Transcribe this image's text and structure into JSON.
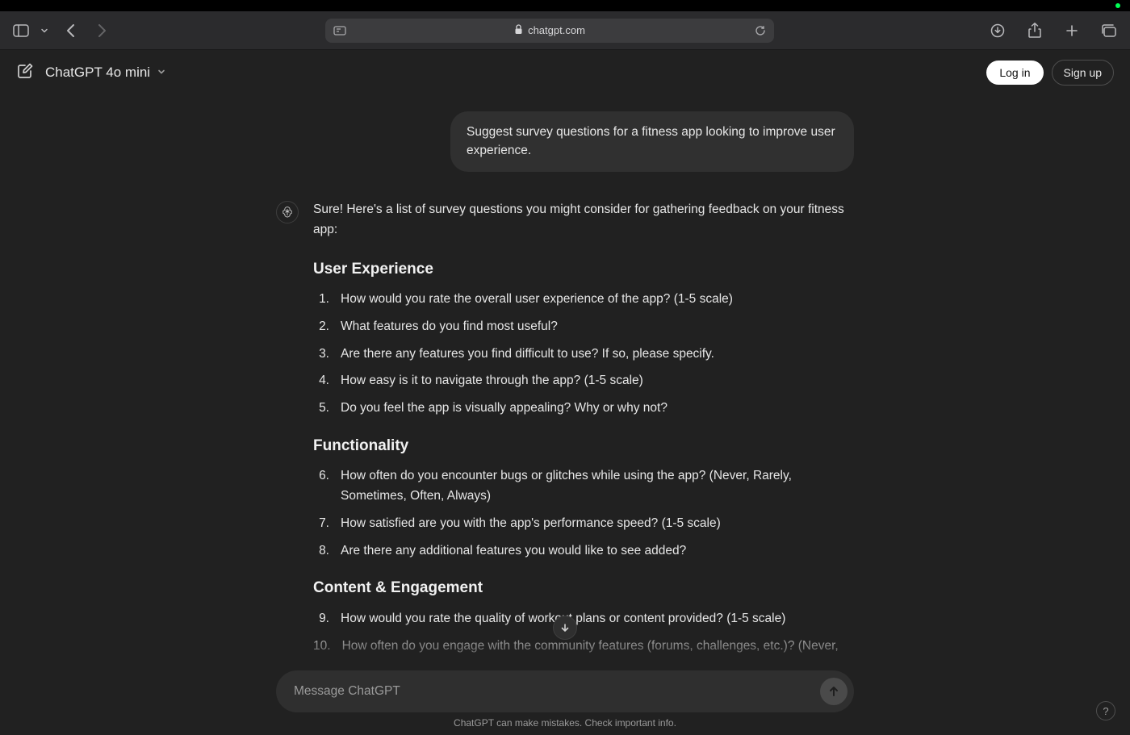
{
  "browser": {
    "url_host": "chatgpt.com"
  },
  "header": {
    "model_label": "ChatGPT 4o mini",
    "login_label": "Log in",
    "signup_label": "Sign up"
  },
  "user_message": "Suggest survey questions for a fitness app looking to improve user experience.",
  "assistant": {
    "intro": "Sure! Here's a list of survey questions you might consider for gathering feedback on your fitness app:",
    "sections": [
      {
        "heading": "User Experience",
        "start": 1,
        "items": [
          "How would you rate the overall user experience of the app? (1-5 scale)",
          "What features do you find most useful?",
          "Are there any features you find difficult to use? If so, please specify.",
          "How easy is it to navigate through the app? (1-5 scale)",
          "Do you feel the app is visually appealing? Why or why not?"
        ]
      },
      {
        "heading": "Functionality",
        "start": 6,
        "items": [
          "How often do you encounter bugs or glitches while using the app? (Never, Rarely, Sometimes, Often, Always)",
          "How satisfied are you with the app's performance speed? (1-5 scale)",
          "Are there any additional features you would like to see added?"
        ]
      },
      {
        "heading": "Content & Engagement",
        "start": 9,
        "items": [
          "How would you rate the quality of workout plans or content provided? (1-5 scale)",
          "How often do you engage with the community features (forums, challenges, etc.)? (Never,"
        ]
      }
    ]
  },
  "composer": {
    "placeholder": "Message ChatGPT"
  },
  "disclaimer": "ChatGPT can make mistakes. Check important info.",
  "help_label": "?"
}
